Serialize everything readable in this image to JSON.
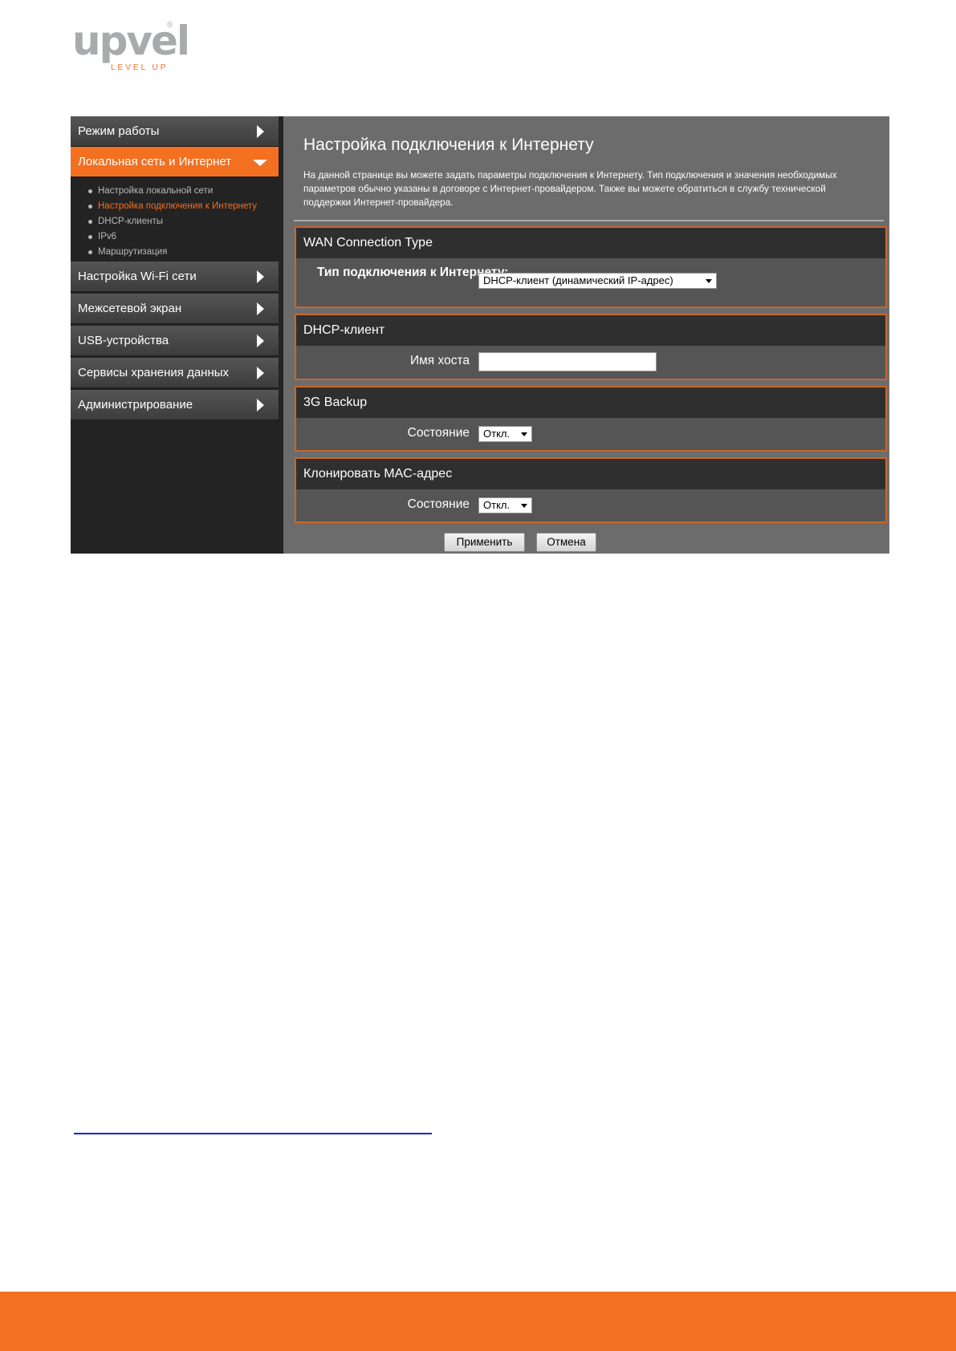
{
  "logo": {
    "word": "upvel",
    "registered": "®",
    "tagline": "LEVEL UP"
  },
  "sidebar": {
    "items": [
      {
        "label": "Режим работы"
      },
      {
        "label": "Локальная сеть и Интернет",
        "expanded": true
      },
      {
        "label": "Настройка Wi-Fi сети"
      },
      {
        "label": "Межсетевой экран"
      },
      {
        "label": "USB-устройства"
      },
      {
        "label": "Сервисы хранения данных"
      },
      {
        "label": "Администрирование"
      }
    ],
    "subitems": [
      {
        "label": "Настройка локальной сети"
      },
      {
        "label": "Настройка подключения к Интернету",
        "current": true
      },
      {
        "label": "DHCP-клиенты"
      },
      {
        "label": "IPv6"
      },
      {
        "label": "Маршрутизация"
      }
    ]
  },
  "main": {
    "title": "Настройка подключения к Интернету",
    "description": "На данной странице вы можете задать параметры подключения к Интернету. Тип подключения и значения необходимых параметров обычно указаны в договоре с Интернет-провайдером. Также вы можете обратиться в службу технической поддержки Интернет-провайдера.",
    "wan": {
      "title": "WAN Connection Type",
      "label": "Тип подключения к Интернету:",
      "value": "DHCP-клиент (динамический IP-адрес)"
    },
    "dhcp": {
      "title": "DHCP-клиент",
      "label": "Имя хоста",
      "value": ""
    },
    "backup": {
      "title": "3G Backup",
      "label": "Состояние",
      "value": "Откл."
    },
    "clone": {
      "title": "Клонировать MAC-адрес",
      "label": "Состояние",
      "value": "Откл."
    },
    "apply_label": "Применить",
    "cancel_label": "Отмена"
  },
  "colors": {
    "accent": "#f37021",
    "sidebar_bg": "#232323",
    "content_bg": "#6c6c6c"
  }
}
